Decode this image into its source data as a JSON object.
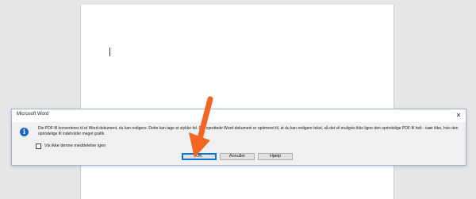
{
  "document": {
    "cursor_icon": "text-cursor"
  },
  "dialog": {
    "title": "Microsoft Word",
    "close_label": "✕",
    "info_icon": "i",
    "message": "Din PDF-fil konverteres til et Word-dokument, du kan redigere. Dette kan tage et stykke tid. Det oprettede Word-dokument er optimeret til, at du kan redigere tekst, så det vil muligvis ikke ligne den oprindelige PDF-fil helt - især ikke, hvis den oprindelige fil indeholder meget grafik.",
    "checkbox_label": "Vis ikke denne meddelelse igen",
    "checkbox_checked": false,
    "buttons": {
      "ok": "OK",
      "cancel": "Annuller",
      "help": "Hjælp"
    }
  },
  "annotation": {
    "icon": "arrow-pointer-icon",
    "color": "#f26522"
  },
  "colors": {
    "accent": "#0078d7",
    "info": "#1f63c6"
  }
}
